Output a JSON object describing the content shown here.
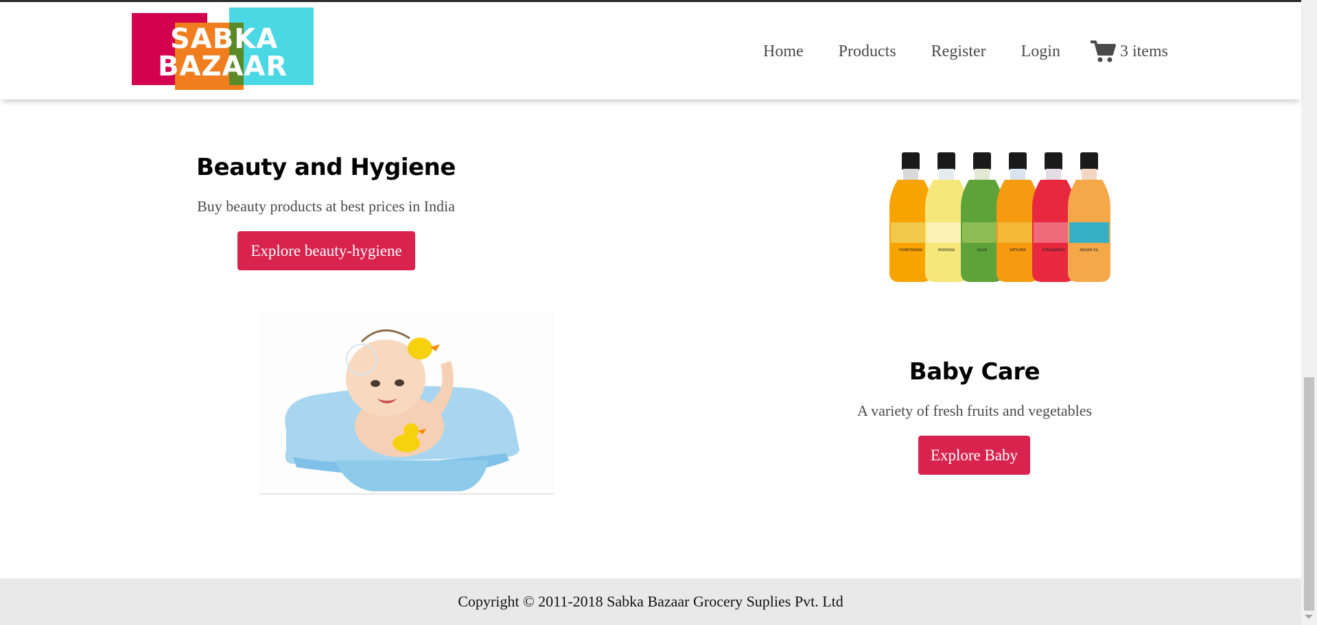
{
  "logo": {
    "line1": "SABKA",
    "line2": "BAZAAR"
  },
  "nav": {
    "home": "Home",
    "products": "Products",
    "register": "Register",
    "login": "Login",
    "cart_label": "3 items",
    "cart_icon": "cart-icon"
  },
  "sections": [
    {
      "title": "Beauty and Hygiene",
      "description": "Buy beauty products at best prices in India",
      "button": "Explore beauty-hygiene"
    },
    {
      "title": "Baby Care",
      "description": "A variety of fresh fruits and vegetables",
      "button": "Explore Baby"
    }
  ],
  "bottle_labels": [
    "HONEYMANIA",
    "MORINGA",
    "OLIVE",
    "SATSUMA",
    "STRAWBERRY",
    "ARGAN OIL"
  ],
  "footer": {
    "copyright": "Copyright © 2011-2018 Sabka Bazaar Grocery Suplies Pvt. Ltd"
  },
  "colors": {
    "accent": "#d8234e",
    "footer_bg": "#e9e9e9"
  }
}
